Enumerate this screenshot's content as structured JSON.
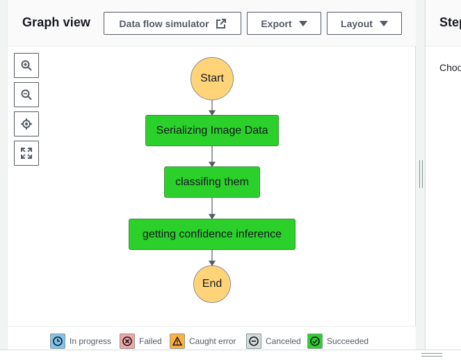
{
  "graph": {
    "title": "Graph view",
    "buttons": {
      "simulator": "Data flow simulator",
      "export": "Export",
      "layout": "Layout"
    },
    "tools": [
      "zoom-in",
      "zoom-out",
      "center",
      "fit-to-screen"
    ],
    "nodes": {
      "start": "Start",
      "step1": "Serializing Image Data",
      "step2": "classifing them",
      "step3": "getting confidence inference",
      "end": "End"
    },
    "colors": {
      "terminal": "#ffd479",
      "succeeded": "#2bd02b"
    }
  },
  "legend": {
    "in_progress": "In progress",
    "failed": "Failed",
    "caught_error": "Caught error",
    "canceled": "Canceled",
    "succeeded": "Succeeded"
  },
  "step_panel": {
    "title": "Step",
    "body": "Choo"
  }
}
